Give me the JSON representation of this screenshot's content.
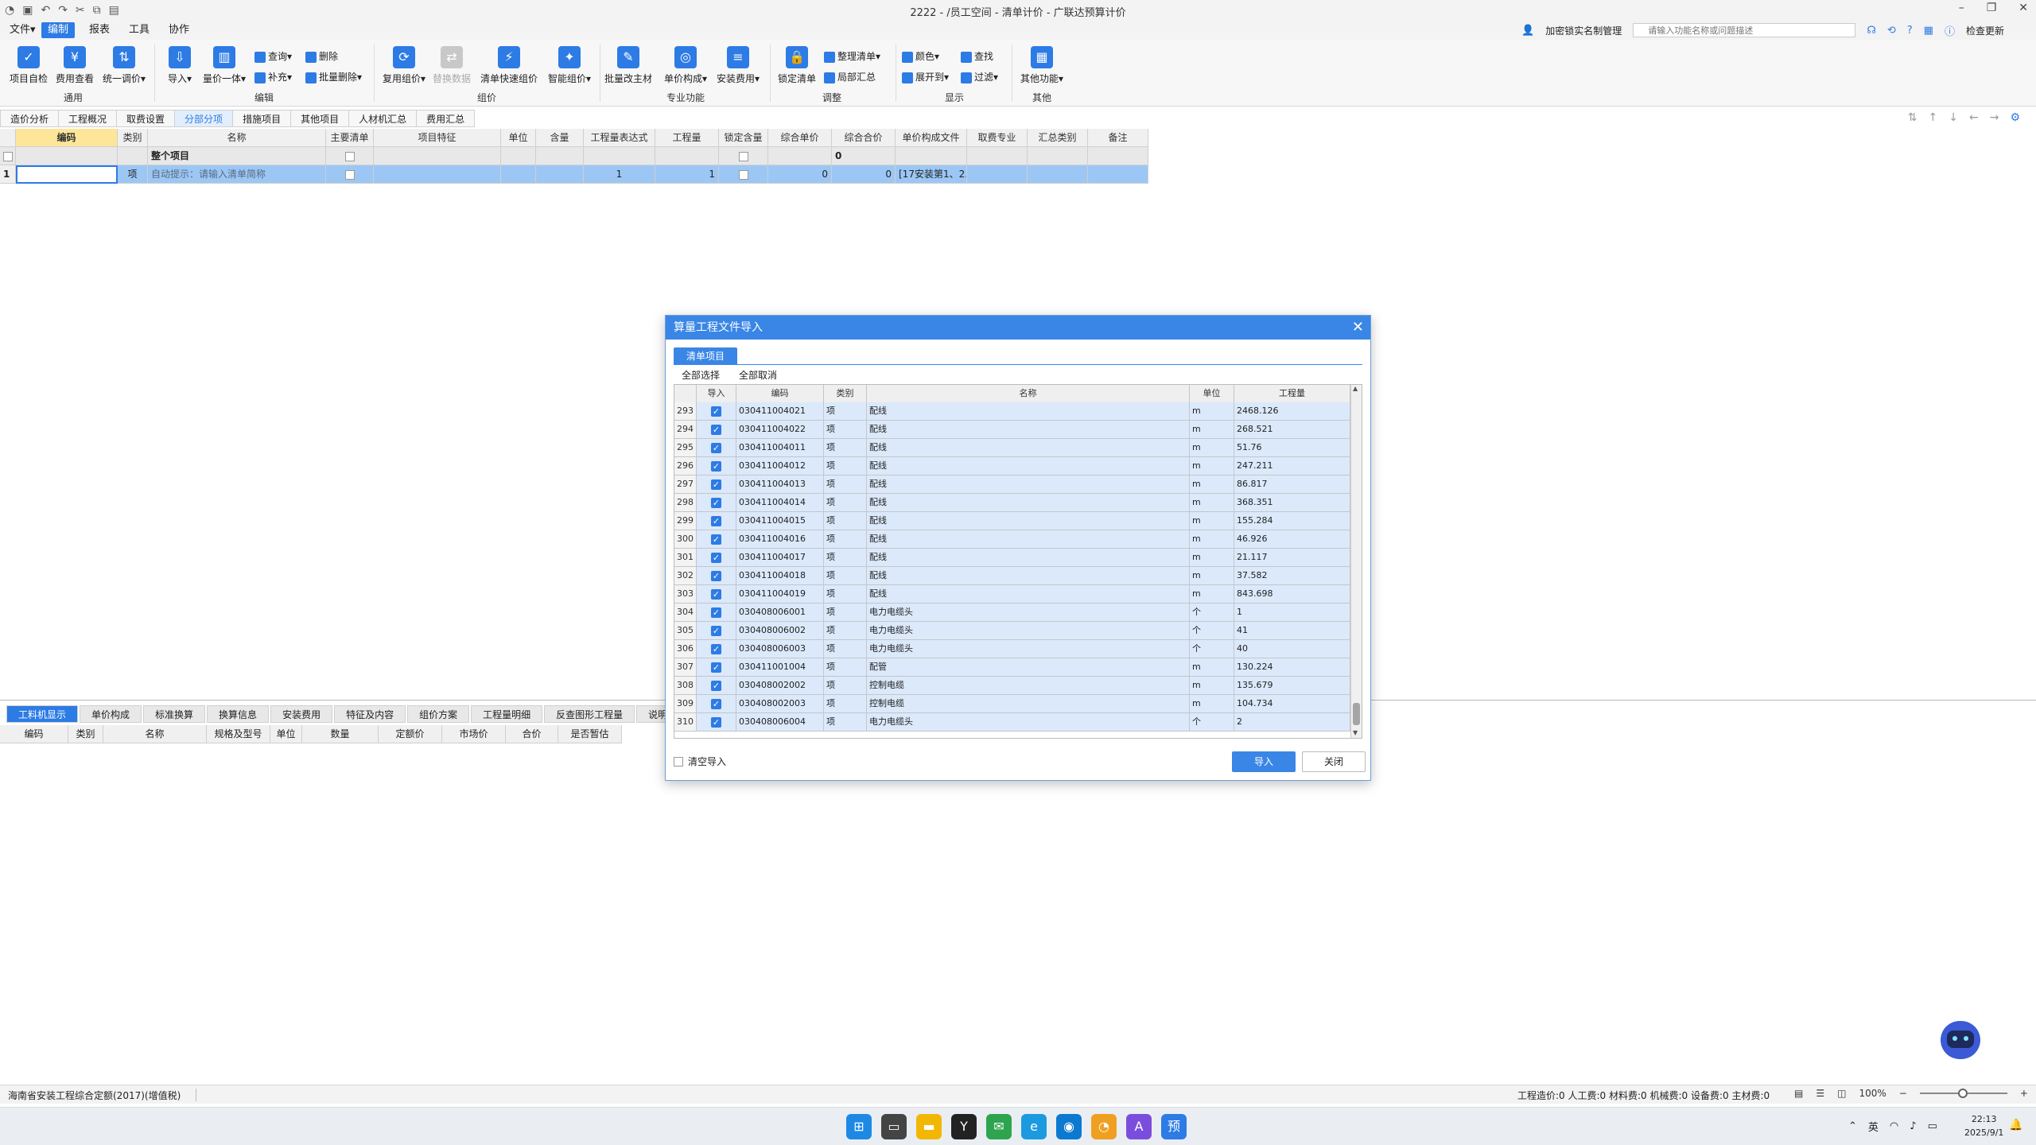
{
  "window": {
    "title": "2222 - /员工空间 - 清单计价 - 广联达预算计价",
    "controls": [
      "–",
      "❐",
      "✕"
    ]
  },
  "menu": {
    "items": [
      "文件▾",
      "编制",
      "报表",
      "工具",
      "协作"
    ],
    "active_index": 1,
    "real_name_link": "加密锁实名制管理",
    "search_placeholder": "请输入功能名称或问题描述",
    "check_update": "检查更新"
  },
  "ribbon": {
    "buttons": [
      {
        "label": "项目自检",
        "icon": "✓"
      },
      {
        "label": "费用查看",
        "icon": "¥"
      },
      {
        "label": "统一调价▾",
        "icon": "⇅"
      },
      {
        "label": "导入▾",
        "icon": "⇩"
      },
      {
        "label": "量价一体▾",
        "icon": "▥"
      },
      {
        "label": "复用组价▾",
        "icon": "⟳"
      },
      {
        "label": "替换数据",
        "icon": "⇄",
        "disabled": true
      },
      {
        "label": "清单快速组价",
        "icon": "⚡"
      },
      {
        "label": "智能组价▾",
        "icon": "✦"
      },
      {
        "label": "批量改主材",
        "icon": "✎"
      },
      {
        "label": "单价构成▾",
        "icon": "◎"
      },
      {
        "label": "安装费用▾",
        "icon": "≡"
      },
      {
        "label": "锁定清单",
        "icon": "🔒"
      },
      {
        "label": "其他功能▾",
        "icon": "▦"
      }
    ],
    "small_buttons": [
      "查询▾",
      "删除",
      "补充▾",
      "批量删除▾",
      "整理清单▾",
      "局部汇总",
      "颜色▾",
      "查找",
      "展开到▾",
      "过滤▾"
    ],
    "groups": [
      "通用",
      "编辑",
      "组价",
      "专业功能",
      "调整",
      "显示",
      "其他"
    ]
  },
  "main_tabs": {
    "items": [
      "造价分析",
      "工程概况",
      "取费设置",
      "分部分项",
      "措施项目",
      "其他项目",
      "人材机汇总",
      "费用汇总"
    ],
    "active_index": 3
  },
  "main_grid": {
    "columns": [
      "",
      "编码",
      "类别",
      "名称",
      "主要清单",
      "项目特征",
      "单位",
      "含量",
      "工程量表达式",
      "工程量",
      "锁定含量",
      "综合单价",
      "综合合价",
      "单价构成文件",
      "取费专业",
      "汇总类别",
      "备注"
    ],
    "total_row": {
      "code": "",
      "name": "整个项目",
      "total_price": "0"
    },
    "rows": [
      {
        "index": "1",
        "code": "",
        "type": "项",
        "name": "自动提示：请输入清单简称",
        "unit": "",
        "qty_expr": "1",
        "qty": "1",
        "unit_price": "0",
        "total_price": "0",
        "price_file": "[17安装第1、2..."
      }
    ]
  },
  "lower_panel": {
    "tabs": [
      "工料机显示",
      "单价构成",
      "标准换算",
      "换算信息",
      "安装费用",
      "特征及内容",
      "组价方案",
      "工程量明细",
      "反查图形工程量",
      "说明"
    ],
    "active_index": 0,
    "columns": [
      "编码",
      "类别",
      "名称",
      "规格及型号",
      "单位",
      "数量",
      "定额价",
      "市场价",
      "合价",
      "是否暂估"
    ]
  },
  "dialog": {
    "title": "算量工程文件导入",
    "tab": "清单项目",
    "select_all": "全部选择",
    "deselect_all": "全部取消",
    "columns": [
      "",
      "导入",
      "编码",
      "类别",
      "名称",
      "单位",
      "工程量"
    ],
    "rows": [
      {
        "n": "293",
        "code": "030411004021",
        "type": "项",
        "name": "配线",
        "unit": "m",
        "qty": "2468.126"
      },
      {
        "n": "294",
        "code": "030411004022",
        "type": "项",
        "name": "配线",
        "unit": "m",
        "qty": "268.521"
      },
      {
        "n": "295",
        "code": "030411004011",
        "type": "项",
        "name": "配线",
        "unit": "m",
        "qty": "51.76"
      },
      {
        "n": "296",
        "code": "030411004012",
        "type": "项",
        "name": "配线",
        "unit": "m",
        "qty": "247.211"
      },
      {
        "n": "297",
        "code": "030411004013",
        "type": "项",
        "name": "配线",
        "unit": "m",
        "qty": "86.817"
      },
      {
        "n": "298",
        "code": "030411004014",
        "type": "项",
        "name": "配线",
        "unit": "m",
        "qty": "368.351"
      },
      {
        "n": "299",
        "code": "030411004015",
        "type": "项",
        "name": "配线",
        "unit": "m",
        "qty": "155.284"
      },
      {
        "n": "300",
        "code": "030411004016",
        "type": "项",
        "name": "配线",
        "unit": "m",
        "qty": "46.926"
      },
      {
        "n": "301",
        "code": "030411004017",
        "type": "项",
        "name": "配线",
        "unit": "m",
        "qty": "21.117"
      },
      {
        "n": "302",
        "code": "030411004018",
        "type": "项",
        "name": "配线",
        "unit": "m",
        "qty": "37.582"
      },
      {
        "n": "303",
        "code": "030411004019",
        "type": "项",
        "name": "配线",
        "unit": "m",
        "qty": "843.698"
      },
      {
        "n": "304",
        "code": "030408006001",
        "type": "项",
        "name": "电力电缆头",
        "unit": "个",
        "qty": "1"
      },
      {
        "n": "305",
        "code": "030408006002",
        "type": "项",
        "name": "电力电缆头",
        "unit": "个",
        "qty": "41"
      },
      {
        "n": "306",
        "code": "030408006003",
        "type": "项",
        "name": "电力电缆头",
        "unit": "个",
        "qty": "40"
      },
      {
        "n": "307",
        "code": "030411001004",
        "type": "项",
        "name": "配管",
        "unit": "m",
        "qty": "130.224"
      },
      {
        "n": "308",
        "code": "030408002002",
        "type": "项",
        "name": "控制电缆",
        "unit": "m",
        "qty": "135.679"
      },
      {
        "n": "309",
        "code": "030408002003",
        "type": "项",
        "name": "控制电缆",
        "unit": "m",
        "qty": "104.734"
      },
      {
        "n": "310",
        "code": "030408006004",
        "type": "项",
        "name": "电力电缆头",
        "unit": "个",
        "qty": "2"
      }
    ],
    "clear_import_label": "清空导入",
    "import_button": "导入",
    "close_button": "关闭"
  },
  "status": {
    "quota": "海南省安装工程综合定额(2017)(增值税)",
    "summary": "工程造价:0   人工费:0   材料费:0   机械费:0   设备费:0   主材费:0",
    "zoom": "100%"
  },
  "taskbar": {
    "ime": "英",
    "time": "22:13",
    "date": "2025/9/1"
  },
  "colors": {
    "accent": "#2d7be5",
    "dialog_header": "#3a86e6",
    "row_highlight": "#dbe9fb"
  }
}
